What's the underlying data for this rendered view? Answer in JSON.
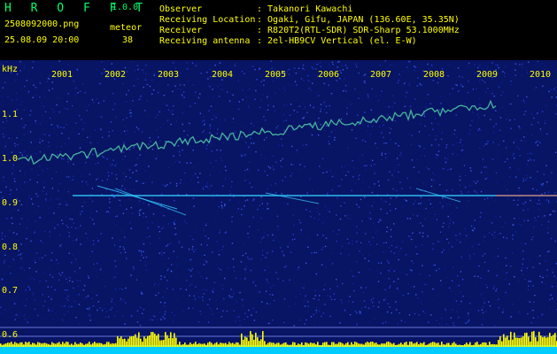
{
  "header": {
    "app_title": "H R O F F T",
    "version": "1.0.0",
    "file_name": "2508092000.png",
    "meteor_label": "meteor",
    "date_time": "25.08.09 20:00",
    "meteor_count": "38",
    "info_rows": [
      {
        "label": "Observer",
        "value": ": Takanori Kawachi"
      },
      {
        "label": "Receiving Location",
        "value": ": Ogaki, Gifu, JAPAN (136.60E, 35.35N)"
      },
      {
        "label": "Receiver",
        "value": ": R820T2(RTL-SDR) SDR-Sharp 53.1000MHz"
      },
      {
        "label": "Receiving antenna",
        "value": ": 2el-HB9CV Vertical (el. E-W)"
      }
    ]
  },
  "axes": {
    "y_unit": "kHz",
    "y_ticks": [
      "1.1",
      "1.0",
      "0.9",
      "0.8",
      "0.7",
      "0.6"
    ],
    "x_ticks": [
      "2001",
      "2002",
      "2003",
      "2004",
      "2005",
      "2006",
      "2007",
      "2008",
      "2009",
      "2010"
    ]
  },
  "colors": {
    "text_yellow": "#ffff00",
    "text_green": "#00ff66",
    "background_noise": "#0a1a6e",
    "signal_cyan": "#33ccff",
    "meteor_bar": "#ffff00",
    "baseline_cyan": "#00ccff"
  }
}
